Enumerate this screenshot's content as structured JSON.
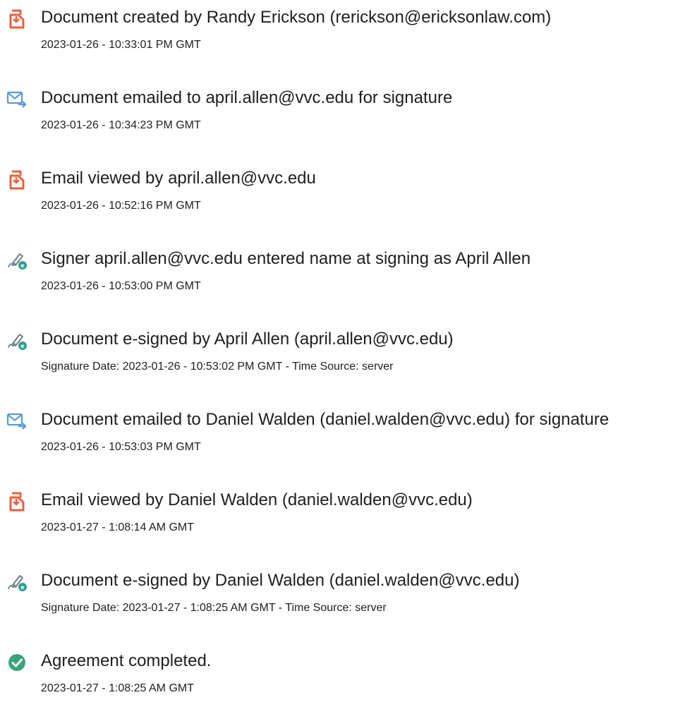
{
  "colors": {
    "created_icon": "#e8603c",
    "emailed_icon": "#5b9bd5",
    "signed_pen": "#6b7f86",
    "signed_badge": "#2f9e8f",
    "completed_icon": "#3aa37a"
  },
  "events": [
    {
      "icon": "document-created-icon",
      "title": "Document created by Randy Erickson (rerickson@ericksonlaw.com)",
      "meta": "2023-01-26 - 10:33:01 PM GMT"
    },
    {
      "icon": "email-sent-icon",
      "title": "Document emailed to april.allen@vvc.edu for signature",
      "meta": "2023-01-26 - 10:34:23 PM GMT"
    },
    {
      "icon": "document-viewed-icon",
      "title": "Email viewed by april.allen@vvc.edu",
      "meta": "2023-01-26 - 10:52:16 PM GMT"
    },
    {
      "icon": "e-sign-pen-icon",
      "title": "Signer april.allen@vvc.edu entered name at signing as April Allen",
      "meta": "2023-01-26 - 10:53:00 PM GMT"
    },
    {
      "icon": "e-sign-pen-icon",
      "title": "Document e-signed by April Allen (april.allen@vvc.edu)",
      "meta": "Signature Date: 2023-01-26 - 10:53:02 PM GMT - Time Source: server"
    },
    {
      "icon": "email-sent-icon",
      "title": "Document emailed to Daniel Walden (daniel.walden@vvc.edu) for signature",
      "meta": "2023-01-26 - 10:53:03 PM GMT"
    },
    {
      "icon": "document-viewed-icon",
      "title": "Email viewed by Daniel Walden (daniel.walden@vvc.edu)",
      "meta": "2023-01-27 - 1:08:14 AM GMT"
    },
    {
      "icon": "e-sign-pen-icon",
      "title": "Document e-signed by Daniel Walden (daniel.walden@vvc.edu)",
      "meta": "Signature Date: 2023-01-27 - 1:08:25 AM GMT - Time Source: server"
    },
    {
      "icon": "checkmark-circle-icon",
      "title": "Agreement completed.",
      "meta": "2023-01-27 - 1:08:25 AM GMT"
    }
  ]
}
